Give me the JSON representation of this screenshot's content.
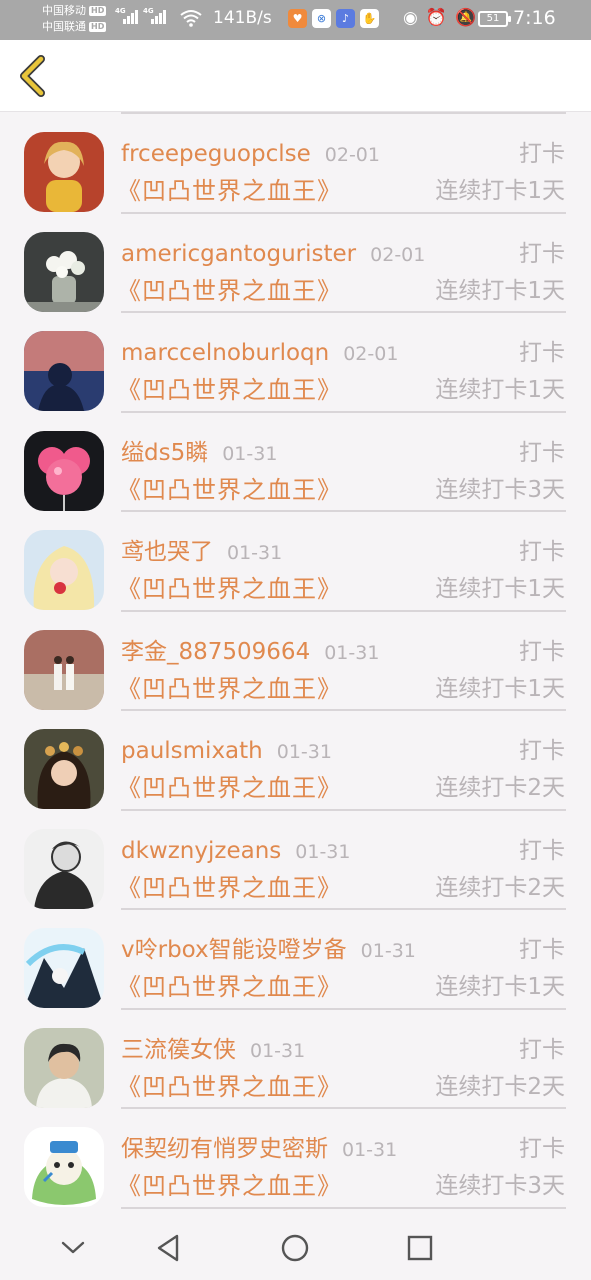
{
  "status_bar": {
    "carrier1": "中国移动",
    "carrier2": "中国联通",
    "hd": "HD",
    "net_type": "4G",
    "net_speed": "141B/s",
    "battery": "51",
    "time": "7:16"
  },
  "colors": {
    "accent": "#e0894e",
    "muted": "#b9b4b7",
    "divider": "#d9d5d8",
    "back_arrow": "#e8c53a"
  },
  "entries": [
    {
      "name": "frceepeguopclse",
      "date": "02-01",
      "action": "打卡",
      "book": "《凹凸世界之血王》",
      "streak": "连续打卡1天"
    },
    {
      "name": "americgantogurister",
      "date": "02-01",
      "action": "打卡",
      "book": "《凹凸世界之血王》",
      "streak": "连续打卡1天"
    },
    {
      "name": "marccelnoburloqn",
      "date": "02-01",
      "action": "打卡",
      "book": "《凹凸世界之血王》",
      "streak": "连续打卡1天"
    },
    {
      "name": "缢ds5瞵",
      "date": "01-31",
      "action": "打卡",
      "book": "《凹凸世界之血王》",
      "streak": "连续打卡3天"
    },
    {
      "name": "鸢也哭了",
      "date": "01-31",
      "action": "打卡",
      "book": "《凹凸世界之血王》",
      "streak": "连续打卡1天"
    },
    {
      "name": "李金_887509664",
      "date": "01-31",
      "action": "打卡",
      "book": "《凹凸世界之血王》",
      "streak": "连续打卡1天"
    },
    {
      "name": "paulsmixath",
      "date": "01-31",
      "action": "打卡",
      "book": "《凹凸世界之血王》",
      "streak": "连续打卡2天"
    },
    {
      "name": "dkwznyjzeans",
      "date": "01-31",
      "action": "打卡",
      "book": "《凹凸世界之血王》",
      "streak": "连续打卡2天"
    },
    {
      "name": "v呤rbox智能设噔岁备",
      "date": "01-31",
      "action": "打卡",
      "book": "《凹凸世界之血王》",
      "streak": "连续打卡1天"
    },
    {
      "name": "三流篌女侠",
      "date": "01-31",
      "action": "打卡",
      "book": "《凹凸世界之血王》",
      "streak": "连续打卡2天"
    },
    {
      "name": "保契纫有悄罗史密斯",
      "date": "01-31",
      "action": "打卡",
      "book": "《凹凸世界之血王》",
      "streak": "连续打卡3天"
    }
  ]
}
